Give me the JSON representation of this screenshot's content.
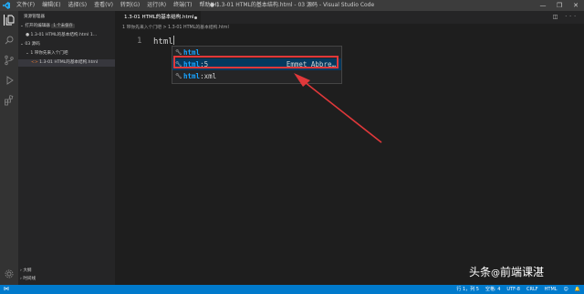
{
  "menu": [
    "文件(F)",
    "编辑(E)",
    "选择(S)",
    "查看(V)",
    "转到(G)",
    "运行(R)",
    "终端(T)",
    "帮助(H)"
  ],
  "window_title": "● 1.3-01 HTML的基本结构.html - 03 源码 - Visual Studio Code",
  "window_controls": [
    "—",
    "❐",
    "✕"
  ],
  "sidebar": {
    "header": "资源管理器",
    "open_editors": "打开的编辑器",
    "unsaved_badge": "1 个未保存",
    "open_file": "1.3-01 HTML的基本结构.html  1...",
    "folder": "03 源码",
    "subfolder": "1 带你先来入个门吧",
    "file": "1.3-01 HTML的基本结构.html",
    "outline": "大纲",
    "timeline": "时间线"
  },
  "tab": {
    "label": "1.3-01 HTML的基本结构.html"
  },
  "tab_actions": "◫ ···",
  "breadcrumb": "1 带你先来入个门吧 > 1.3-01 HTML的基本结构.html",
  "editor": {
    "line_number": "1",
    "code": "html"
  },
  "suggestions": [
    {
      "match": "html",
      "rest": "",
      "detail": "",
      "icon": "wrench-icon"
    },
    {
      "match": "html",
      "rest": ":5",
      "detail": "Emmet Abbre…",
      "icon": "wrench-icon"
    },
    {
      "match": "html",
      "rest": ":xml",
      "detail": "",
      "icon": "wrench-icon"
    }
  ],
  "status": {
    "left_icon": "remote-icon",
    "items": [
      "行 1，列 5",
      "空格: 4",
      "UTF-8",
      "CRLF",
      "HTML",
      "☺",
      "🔔"
    ]
  },
  "watermark": {
    "prefix": "头条",
    "at": "@",
    "name": "前端课湛"
  },
  "colors": {
    "accent": "#007acc",
    "highlight": "#e0383a",
    "match": "#18a3ff"
  }
}
